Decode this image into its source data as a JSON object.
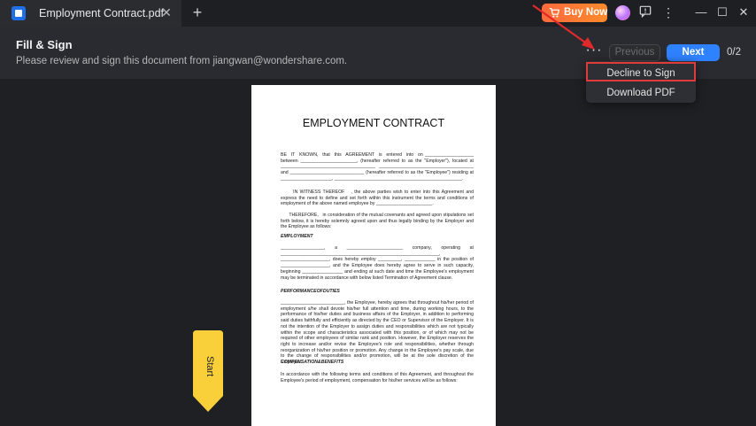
{
  "window": {
    "tab_title": "Employment Contract.pdf",
    "tab_close": "✕",
    "new_tab": "+",
    "buy_now": "Buy Now",
    "more_glyph": "⋮",
    "minimize": "—",
    "maximize": "☐",
    "close": "✕"
  },
  "fill_sign": {
    "title": "Fill & Sign",
    "subtitle": "Please review and sign this document from jiangwan@wondershare.com.",
    "more": "···",
    "previous": "Previous",
    "next": "Next",
    "page_count": "0/2"
  },
  "dropdown": {
    "items": [
      "Decline to Sign",
      "Download PDF"
    ]
  },
  "document": {
    "title": "EMPLOYMENT CONTRACT",
    "p1": "BE  IT  KNOWN,  that  this  AGREEMENT  is  entered  into  on ___________________ between ______________________, (hereafter referred to as the \"Employer\"), located at _____________________________________ _____________________________________ and _____________________________ (hereafter referred to as the \"Employee\") residing at ____________________, __________________________________________________.",
    "p2": "      IN WITNESS THEREOF   , the above parties wish to enter into this Agreement and express the need to define and set forth within this instrument the terms and conditions of employment of the above named employee by ______________________.",
    "p3": "      THEREFORE,   in consideration of the mutual covenants and agreed upon stipulations set forth below, it is hereby solemnly agreed upon and thus legally binding by the Employer and the Employee as follows:",
    "h_employment": "EMPLOYMENT",
    "p4": "_________________, a ______________________ company, operating at ______________________________________________________________, ___________________, does hereby employ _________, ____________ in the position of ___________________, and the Employee does hereby agree to serve in such capacity, beginning ________________ and ending at such date and time the Employee's employment may be terminated in accordance with below listed Termination of Agreement clause.",
    "h_performance": "PERFORMANCEOFDUTIES",
    "p5": "_________________________, the Employee, hereby agrees that throughout his/her period of employment s/he shall devote his/her full attention and time, during working hours, to the performance of his/her duties and business affairs of the Employer, in addition to performing said duties faithfully and efficiently as directed by the CEO or Supervisor of the Employer. It is not the intention of the Employer to assign duties and responsibilities which are not typically within the scope and characteristics associated with this position, or of which may not be required of other employees of similar rank and position. However, the Employer reserves the right to increase and/or revise the Employee's role and responsibilities, whether through reorganization of his/her position or promotion. Any change in the Employee's pay scale, due to the change of responsibilities and/or promotion, will be at the sole discretion of the Employer.",
    "h_compensation": "COMPENSATION&BENEFITS",
    "p6": "In accordance with the following terms and conditions of this Agreement, and throughout the Employee's period of employment, compensation for his/her services will be as follows:"
  },
  "start_tag": {
    "label": "Start",
    "color": "#f9cf3a"
  },
  "colors": {
    "accent": "#2f82ff",
    "buy_now": "#ff7a35",
    "highlight_box": "#e03b3b",
    "arrow": "#e02a2a"
  }
}
